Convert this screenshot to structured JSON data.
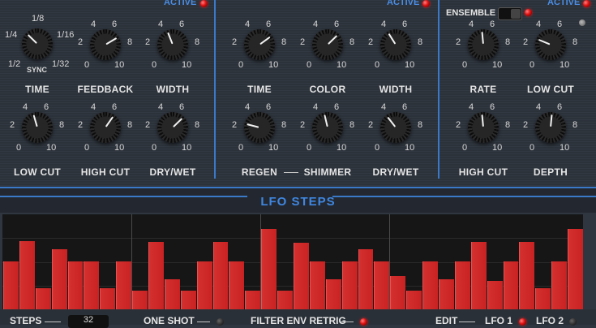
{
  "sections": {
    "delay": {
      "active_label": "ACTIVE",
      "active": true
    },
    "reverb": {
      "active_label": "ACTIVE",
      "active": true
    },
    "chorus": {
      "active_label": "ACTIVE",
      "active": true,
      "ensemble_label": "ENSEMBLE",
      "ensemble_on": true
    }
  },
  "knob_scale": {
    "min": "0",
    "max": "10",
    "t2": "2",
    "t4": "4",
    "t6": "6",
    "t8": "8"
  },
  "time_scale": {
    "a": "1/8",
    "b": "1/4",
    "c": "1/16",
    "d": "1/2",
    "e": "1/32",
    "sync": "SYNC"
  },
  "knobs": {
    "delay_time": {
      "label": "TIME",
      "value": 0.33
    },
    "delay_feedback": {
      "label": "FEEDBACK",
      "value": 0.72
    },
    "delay_width": {
      "label": "WIDTH",
      "value": 0.42
    },
    "delay_lowcut": {
      "label": "LOW CUT",
      "value": 0.44
    },
    "delay_highcut": {
      "label": "HIGH CUT",
      "value": 0.63
    },
    "delay_drywet": {
      "label": "DRY/WET",
      "value": 0.67
    },
    "reverb_time": {
      "label": "TIME",
      "value": 0.7
    },
    "reverb_color": {
      "label": "COLOR",
      "value": 0.67
    },
    "reverb_width": {
      "label": "WIDTH",
      "value": 0.38
    },
    "reverb_regen": {
      "label": "REGEN",
      "value": 0.22
    },
    "reverb_shimmer": {
      "label": "SHIMMER",
      "value": 0.45
    },
    "reverb_drywet": {
      "label": "DRY/WET",
      "value": 0.36
    },
    "chorus_rate": {
      "label": "RATE",
      "value": 0.48
    },
    "chorus_lowcut": {
      "label": "LOW CUT",
      "value": 0.25
    },
    "chorus_highcut": {
      "label": "HIGH CUT",
      "value": 0.48
    },
    "chorus_depth": {
      "label": "DEPTH",
      "value": 0.52
    }
  },
  "lfo": {
    "title": "LFO STEPS",
    "steps": [
      0.5,
      0.72,
      0.22,
      0.63,
      0.5,
      0.5,
      0.22,
      0.5,
      0.2,
      0.71,
      0.32,
      0.2,
      0.5,
      0.71,
      0.5,
      0.2,
      0.85,
      0.2,
      0.7,
      0.5,
      0.32,
      0.5,
      0.63,
      0.5,
      0.35,
      0.2,
      0.5,
      0.32,
      0.5,
      0.71,
      0.3,
      0.5,
      0.71,
      0.22,
      0.5,
      0.85
    ]
  },
  "bottom": {
    "steps_label": "STEPS",
    "steps_value": "32",
    "one_shot": "ONE SHOT",
    "filter_env_retrig": "FILTER ENV RETRIG",
    "edit": "EDIT",
    "lfo1": "LFO 1",
    "lfo2": "LFO 2"
  },
  "colors": {
    "accent": "#3a78c8",
    "led_on": "#e01010",
    "bar": "#cc2424"
  }
}
